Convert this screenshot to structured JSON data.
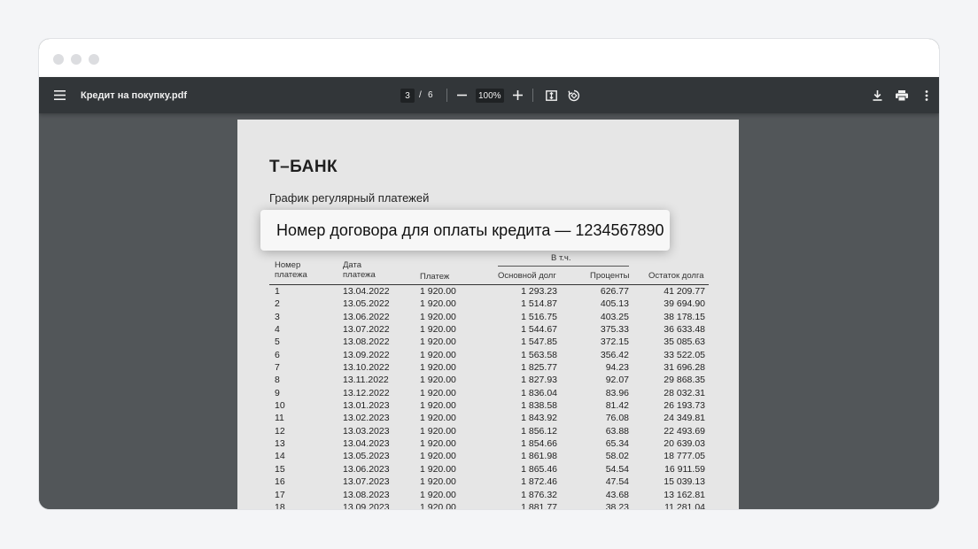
{
  "toolbar": {
    "filename": "Кредит на покупку.pdf",
    "page_current": "3",
    "page_separator": "/",
    "page_total": "6",
    "zoom": "100%"
  },
  "document": {
    "logo": "Т–БАНК",
    "title": "График регулярный платежей",
    "callout": "Номер договора для оплаты кредита — 1234567890",
    "table": {
      "headers": {
        "num": [
          "Номер",
          "платежа"
        ],
        "date": [
          "Дата",
          "платежа"
        ],
        "payment": "Платеж",
        "group": "В т.ч.",
        "principal": "Основной долг",
        "interest": "Проценты",
        "balance": "Остаток долга"
      },
      "rows": [
        [
          "1",
          "13.04.2022",
          "1 920.00",
          "1 293.23",
          "626.77",
          "41 209.77"
        ],
        [
          "2",
          "13.05.2022",
          "1 920.00",
          "1 514.87",
          "405.13",
          "39 694.90"
        ],
        [
          "3",
          "13.06.2022",
          "1 920.00",
          "1 516.75",
          "403.25",
          "38 178.15"
        ],
        [
          "4",
          "13.07.2022",
          "1 920.00",
          "1 544.67",
          "375.33",
          "36 633.48"
        ],
        [
          "5",
          "13.08.2022",
          "1 920.00",
          "1 547.85",
          "372.15",
          "35 085.63"
        ],
        [
          "6",
          "13.09.2022",
          "1 920.00",
          "1 563.58",
          "356.42",
          "33 522.05"
        ],
        [
          "7",
          "13.10.2022",
          "1 920.00",
          "1 825.77",
          "94.23",
          "31 696.28"
        ],
        [
          "8",
          "13.11.2022",
          "1 920.00",
          "1 827.93",
          "92.07",
          "29 868.35"
        ],
        [
          "9",
          "13.12.2022",
          "1 920.00",
          "1 836.04",
          "83.96",
          "28 032.31"
        ],
        [
          "10",
          "13.01.2023",
          "1 920.00",
          "1 838.58",
          "81.42",
          "26 193.73"
        ],
        [
          "11",
          "13.02.2023",
          "1 920.00",
          "1 843.92",
          "76.08",
          "24 349.81"
        ],
        [
          "12",
          "13.03.2023",
          "1 920.00",
          "1 856.12",
          "63.88",
          "22 493.69"
        ],
        [
          "13",
          "13.04.2023",
          "1 920.00",
          "1 854.66",
          "65.34",
          "20 639.03"
        ],
        [
          "14",
          "13.05.2023",
          "1 920.00",
          "1 861.98",
          "58.02",
          "18 777.05"
        ],
        [
          "15",
          "13.06.2023",
          "1 920.00",
          "1 865.46",
          "54.54",
          "16 911.59"
        ],
        [
          "16",
          "13.07.2023",
          "1 920.00",
          "1 872.46",
          "47.54",
          "15 039.13"
        ],
        [
          "17",
          "13.08.2023",
          "1 920.00",
          "1 876.32",
          "43.68",
          "13 162.81"
        ],
        [
          "18",
          "13.09.2023",
          "1 920.00",
          "1 881.77",
          "38.23",
          "11 281.04"
        ]
      ]
    }
  },
  "icons": {
    "menu": "menu-icon",
    "zoom_out": "minus-icon",
    "zoom_in": "plus-icon",
    "fit": "fit-to-page-icon",
    "rotate": "rotate-icon",
    "download": "download-icon",
    "print": "print-icon",
    "more": "more-vertical-icon"
  }
}
